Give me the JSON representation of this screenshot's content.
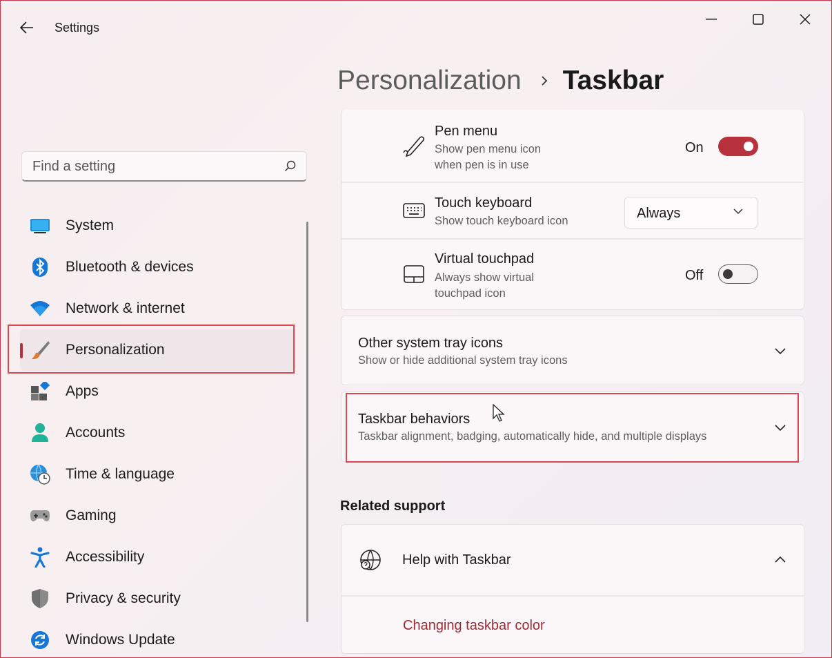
{
  "window": {
    "title": "Settings"
  },
  "header": {
    "parent": "Personalization",
    "current": "Taskbar"
  },
  "search": {
    "placeholder": "Find a setting"
  },
  "sidebar": {
    "items": [
      {
        "label": "System",
        "icon": "monitor-icon"
      },
      {
        "label": "Bluetooth & devices",
        "icon": "bluetooth-icon"
      },
      {
        "label": "Network & internet",
        "icon": "wifi-icon"
      },
      {
        "label": "Personalization",
        "icon": "paintbrush-icon",
        "active": true
      },
      {
        "label": "Apps",
        "icon": "apps-icon"
      },
      {
        "label": "Accounts",
        "icon": "person-icon"
      },
      {
        "label": "Time & language",
        "icon": "globe-clock-icon"
      },
      {
        "label": "Gaming",
        "icon": "gamepad-icon"
      },
      {
        "label": "Accessibility",
        "icon": "accessibility-icon"
      },
      {
        "label": "Privacy & security",
        "icon": "shield-icon"
      },
      {
        "label": "Windows Update",
        "icon": "update-icon"
      }
    ]
  },
  "tray": {
    "pen": {
      "title": "Pen menu",
      "desc1": "Show pen menu icon",
      "desc2": "when pen is in use",
      "state": "On"
    },
    "keyboard": {
      "title": "Touch keyboard",
      "desc": "Show touch keyboard icon",
      "value": "Always"
    },
    "touchpad": {
      "title": "Virtual touchpad",
      "desc1": "Always show virtual",
      "desc2": "touchpad icon",
      "state": "Off"
    }
  },
  "other_tray": {
    "title": "Other system tray icons",
    "desc": "Show or hide additional system tray icons"
  },
  "behaviors": {
    "title": "Taskbar behaviors",
    "desc": "Taskbar alignment, badging, automatically hide, and multiple displays"
  },
  "related": {
    "title": "Related support",
    "help_title": "Help with Taskbar",
    "link": "Changing taskbar color"
  },
  "colors": {
    "accent": "#b8323e",
    "highlight": "#e0454f"
  }
}
